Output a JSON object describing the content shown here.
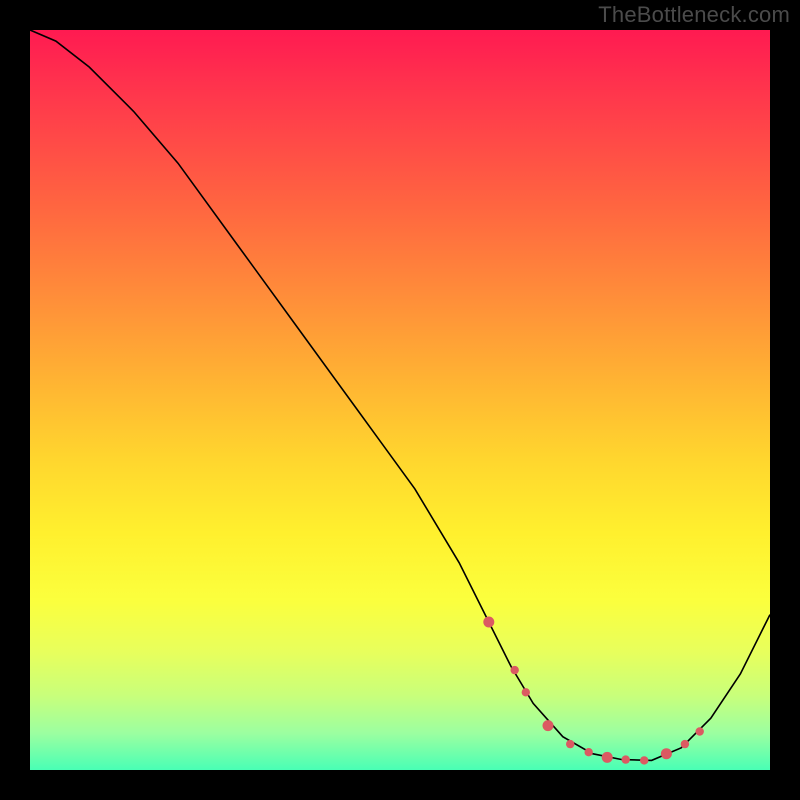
{
  "watermark": "TheBottleneck.com",
  "chart_data": {
    "type": "line",
    "title": "",
    "xlabel": "",
    "ylabel": "",
    "xlim": [
      0,
      100
    ],
    "ylim": [
      0,
      100
    ],
    "series": [
      {
        "name": "curve",
        "x": [
          0,
          3.5,
          8,
          14,
          20,
          28,
          36,
          44,
          52,
          58,
          62,
          65,
          68,
          72,
          76,
          80,
          84,
          88,
          92,
          96,
          100
        ],
        "y": [
          100,
          98.5,
          95,
          89,
          82,
          71,
          60,
          49,
          38,
          28,
          20,
          14,
          9,
          4.5,
          2.2,
          1.4,
          1.3,
          3,
          7,
          13,
          21
        ]
      }
    ],
    "markers": {
      "x": [
        62,
        65.5,
        67,
        70,
        73,
        75.5,
        78,
        80.5,
        83,
        86,
        88.5,
        90.5
      ],
      "y": [
        20,
        13.5,
        10.5,
        6,
        3.5,
        2.4,
        1.7,
        1.4,
        1.3,
        2.2,
        3.5,
        5.2
      ]
    },
    "gradient_colors": {
      "top": "#ff1a51",
      "upper_mid": "#ff8a3a",
      "mid": "#ffd62e",
      "lower_mid": "#e8ff5c",
      "bottom": "#49ffb5"
    }
  }
}
